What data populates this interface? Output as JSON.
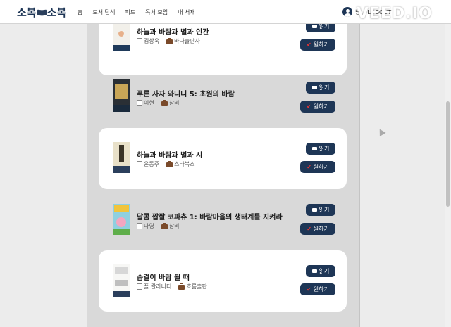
{
  "header": {
    "logo_left": "소복",
    "logo_right": "소복",
    "nav": [
      "홈",
      "도서 탐색",
      "피드",
      "독서 모임",
      "내 서재"
    ],
    "user_name": "님",
    "logout": "LOGOUT",
    "watermark": "VEED.IO"
  },
  "colors": {
    "accent": "#1e3656",
    "card": "#ffffff",
    "column": "#d9d9d9"
  },
  "books": [
    {
      "title": "하늘과 바람과 별과 인간",
      "author": "김상욱",
      "publisher": "바다출판사",
      "read_label": "읽기",
      "want_label": "원하기"
    },
    {
      "title": "푸른 사자 와니니 5: 초원의 바람",
      "author": "이현",
      "publisher": "창비",
      "read_label": "읽기",
      "want_label": "원하기"
    },
    {
      "title": "하늘과 바람과 별과 시",
      "author": "윤동주",
      "publisher": "스타북스",
      "read_label": "읽기",
      "want_label": "원하기"
    },
    {
      "title": "달콤 짭짤 코파츄 1: 바람마을의 생태계를 지켜라",
      "author": "다영",
      "publisher": "창비",
      "read_label": "읽기",
      "want_label": "원하기"
    },
    {
      "title": "숨결이 바람 될 때",
      "author": "폴 칼라니티",
      "publisher": "흐름출판",
      "read_label": "읽기",
      "want_label": "원하기"
    }
  ]
}
